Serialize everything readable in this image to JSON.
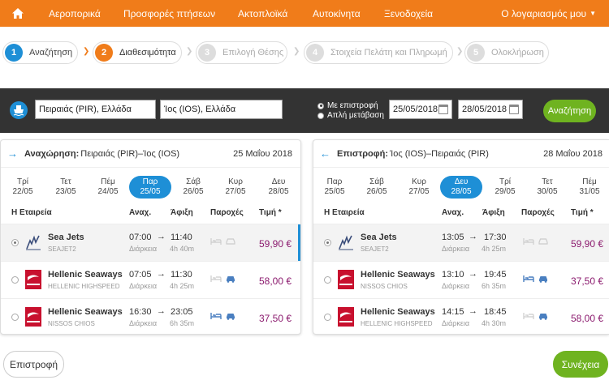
{
  "nav": {
    "items": [
      "Αεροπορικά",
      "Προσφορές πτήσεων",
      "Ακτοπλοϊκά",
      "Αυτοκίνητα",
      "Ξενοδοχεία"
    ],
    "account": "Ο λογαριασμός μου"
  },
  "steps": [
    {
      "num": "1",
      "label": "Αναζήτηση",
      "state": "done"
    },
    {
      "num": "2",
      "label": "Διαθεσιμότητα",
      "state": "current"
    },
    {
      "num": "3",
      "label": "Επιλογή Θέσης",
      "state": "off"
    },
    {
      "num": "4",
      "label": "Στοιχεία Πελάτη και Πληρωμή",
      "state": "off"
    },
    {
      "num": "5",
      "label": "Ολοκλήρωση",
      "state": "off"
    }
  ],
  "search": {
    "from": "Πειραιάς (PIR), Ελλάδα",
    "to": "Ίος (IOS), Ελλάδα",
    "return_option": "Με επιστροφή",
    "oneway_option": "Απλή μετάβαση",
    "depart_date": "25/05/2018",
    "return_date": "28/05/2018",
    "button": "Αναζήτηση"
  },
  "headers": {
    "company": "Η Εταιρεία",
    "dep": "Αναχ.",
    "arr": "Άφιξη",
    "amenities": "Παροχές",
    "price": "Τιμή *",
    "duration": "Διάρκεια"
  },
  "outbound": {
    "label": "Αναχώρηση:",
    "route": "Πειραιάς (PIR)–Ίος (IOS)",
    "date": "25 Μαΐου 2018",
    "days": [
      {
        "d": "Τρί",
        "n": "22/05"
      },
      {
        "d": "Τετ",
        "n": "23/05"
      },
      {
        "d": "Πέμ",
        "n": "24/05"
      },
      {
        "d": "Παρ",
        "n": "25/05",
        "sel": true
      },
      {
        "d": "Σάβ",
        "n": "26/05"
      },
      {
        "d": "Κυρ",
        "n": "27/05"
      },
      {
        "d": "Δευ",
        "n": "28/05"
      }
    ],
    "rows": [
      {
        "company": "Sea Jets",
        "vessel": "SEAJET2",
        "dep": "07:00",
        "arr": "11:40",
        "dur": "4h 40m",
        "price": "59,90 €",
        "sel": true
      },
      {
        "company": "Hellenic Seaways",
        "vessel": "HELLENIC HIGHSPEED",
        "dep": "07:05",
        "arr": "11:30",
        "dur": "4h 25m",
        "price": "58,00 €"
      },
      {
        "company": "Hellenic Seaways",
        "vessel": "NISSOS CHIOS",
        "dep": "16:30",
        "arr": "23:05",
        "dur": "6h 35m",
        "price": "37,50 €"
      }
    ]
  },
  "return": {
    "label": "Επιστροφή:",
    "route": "Ίος (IOS)–Πειραιάς (PIR)",
    "date": "28 Μαΐου 2018",
    "days": [
      {
        "d": "Παρ",
        "n": "25/05"
      },
      {
        "d": "Σάβ",
        "n": "26/05"
      },
      {
        "d": "Κυρ",
        "n": "27/05"
      },
      {
        "d": "Δευ",
        "n": "28/05",
        "sel": true
      },
      {
        "d": "Τρί",
        "n": "29/05"
      },
      {
        "d": "Τετ",
        "n": "30/05"
      },
      {
        "d": "Πέμ",
        "n": "31/05"
      }
    ],
    "rows": [
      {
        "company": "Sea Jets",
        "vessel": "SEAJET2",
        "dep": "13:05",
        "arr": "17:30",
        "dur": "4h 25m",
        "price": "59,90 €",
        "sel": true
      },
      {
        "company": "Hellenic Seaways",
        "vessel": "NISSOS CHIOS",
        "dep": "13:10",
        "arr": "19:45",
        "dur": "6h 35m",
        "price": "37,50 €"
      },
      {
        "company": "Hellenic Seaways",
        "vessel": "HELLENIC HIGHSPEED",
        "dep": "14:15",
        "arr": "18:45",
        "dur": "4h 30m",
        "price": "58,00 €"
      }
    ]
  },
  "footer": {
    "back": "Επιστροφή",
    "next": "Συνέχεια"
  },
  "colors": {
    "orange": "#f07c1a",
    "blue": "#1e8fd6",
    "green": "#6fb320",
    "price": "#8b1a6e"
  }
}
